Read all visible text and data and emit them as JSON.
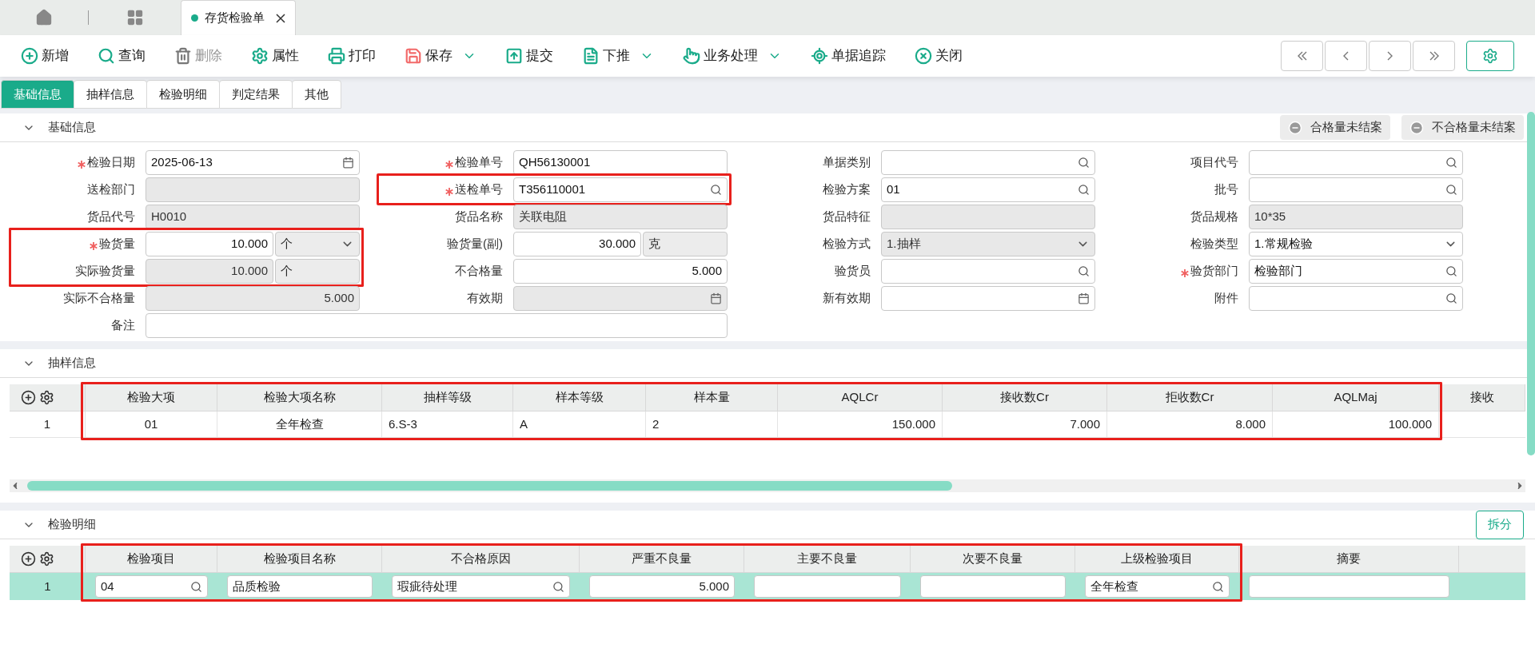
{
  "open_tabs": [
    {
      "label": "存货检验单",
      "selected": true
    }
  ],
  "toolbar": [
    {
      "label": "新增",
      "kind": "add",
      "disabled": false,
      "dropdown": false
    },
    {
      "label": "查询",
      "kind": "search",
      "disabled": false,
      "dropdown": false
    },
    {
      "label": "删除",
      "kind": "delete",
      "disabled": true,
      "dropdown": false
    },
    {
      "label": "属性",
      "kind": "settings",
      "disabled": false,
      "dropdown": false
    },
    {
      "label": "打印",
      "kind": "print",
      "disabled": false,
      "dropdown": false
    },
    {
      "label": "保存",
      "kind": "save",
      "disabled": false,
      "dropdown": true
    },
    {
      "label": "提交",
      "kind": "submit",
      "disabled": false,
      "dropdown": false
    },
    {
      "label": "下推",
      "kind": "push",
      "disabled": false,
      "dropdown": true
    },
    {
      "label": "业务处理",
      "kind": "process",
      "disabled": false,
      "dropdown": true
    },
    {
      "label": "单据追踪",
      "kind": "track",
      "disabled": false,
      "dropdown": false
    },
    {
      "label": "关闭",
      "kind": "close",
      "disabled": false,
      "dropdown": false
    }
  ],
  "section_tabs": [
    {
      "label": "基础信息",
      "selected": true
    },
    {
      "label": "抽样信息",
      "selected": false
    },
    {
      "label": "检验明细",
      "selected": false
    },
    {
      "label": "判定结果",
      "selected": false
    },
    {
      "label": "其他",
      "selected": false
    }
  ],
  "basic_info": {
    "title": "基础信息",
    "expanded": true,
    "status_buttons": [
      "合格量未结案",
      "不合格量未结案"
    ],
    "columns": [
      [
        {
          "label": "检验日期",
          "required": true,
          "kind": "date",
          "value": "2025-06-13",
          "readonly": false,
          "highlighted": false
        },
        {
          "label": "送检部门",
          "required": false,
          "kind": "text",
          "readonly": true,
          "highlighted": false
        },
        {
          "label": "货品代号",
          "required": false,
          "kind": "text",
          "value": "H0010",
          "readonly": true,
          "highlighted": false
        },
        {
          "label": "验货量",
          "required": true,
          "kind": "number",
          "value": "10.000",
          "readonly": false,
          "highlighted": true,
          "unit": {
            "value": "个",
            "kind": "select"
          }
        },
        {
          "label": "实际验货量",
          "required": false,
          "kind": "number",
          "value": "10.000",
          "readonly": true,
          "highlighted": true,
          "unit": {
            "value": "个",
            "kind": "text"
          }
        },
        {
          "label": "实际不合格量",
          "required": false,
          "kind": "number",
          "value": "5.000",
          "readonly": true,
          "highlighted": false
        }
      ],
      [
        {
          "label": "检验单号",
          "required": true,
          "kind": "text",
          "value": "QH56130001",
          "readonly": false,
          "highlighted": false
        },
        {
          "label": "送检单号",
          "required": true,
          "kind": "lookup",
          "value": "T356110001",
          "readonly": false,
          "highlighted": true
        },
        {
          "label": "货品名称",
          "required": false,
          "kind": "text",
          "value": "关联电阻",
          "readonly": true,
          "highlighted": false
        },
        {
          "label": "验货量(副)",
          "required": false,
          "kind": "number",
          "value": "30.000",
          "readonly": false,
          "highlighted": false,
          "unit": {
            "value": "克",
            "kind": "text"
          }
        },
        {
          "label": "不合格量",
          "required": false,
          "kind": "number",
          "value": "5.000",
          "readonly": false,
          "highlighted": false
        },
        {
          "label": "有效期",
          "required": false,
          "kind": "date",
          "readonly": true,
          "highlighted": false
        }
      ],
      [
        {
          "label": "单据类别",
          "required": false,
          "kind": "lookup",
          "readonly": false,
          "highlighted": false
        },
        {
          "label": "检验方案",
          "required": false,
          "kind": "lookup",
          "value": "01",
          "readonly": false,
          "highlighted": false
        },
        {
          "label": "货品特征",
          "required": false,
          "kind": "text",
          "readonly": true,
          "highlighted": false
        },
        {
          "label": "检验方式",
          "required": false,
          "kind": "select",
          "value": "1.抽样",
          "readonly": true,
          "highlighted": false
        },
        {
          "label": "验货员",
          "required": false,
          "kind": "lookup",
          "readonly": false,
          "highlighted": false
        },
        {
          "label": "新有效期",
          "required": false,
          "kind": "date",
          "readonly": false,
          "highlighted": false
        }
      ],
      [
        {
          "label": "项目代号",
          "required": false,
          "kind": "lookup",
          "readonly": false,
          "highlighted": false
        },
        {
          "label": "批号",
          "required": false,
          "kind": "lookup",
          "readonly": false,
          "highlighted": false
        },
        {
          "label": "货品规格",
          "required": false,
          "kind": "text",
          "value": "10*35",
          "readonly": true,
          "highlighted": false
        },
        {
          "label": "检验类型",
          "required": false,
          "kind": "select",
          "value": "1.常规检验",
          "readonly": false,
          "highlighted": false
        },
        {
          "label": "验货部门",
          "required": true,
          "kind": "lookup",
          "value": "检验部门",
          "readonly": false,
          "highlighted": false
        },
        {
          "label": "附件",
          "required": false,
          "kind": "lookup",
          "readonly": false,
          "highlighted": false
        }
      ]
    ],
    "remark": {
      "label": "备注",
      "required": false,
      "kind": "text",
      "readonly": false,
      "highlighted": false
    }
  },
  "sampling": {
    "title": "抽样信息",
    "expanded": true,
    "columns": [
      {
        "label": "检验大项",
        "highlighted": true
      },
      {
        "label": "检验大项名称",
        "highlighted": true
      },
      {
        "label": "抽样等级",
        "highlighted": true
      },
      {
        "label": "样本等级",
        "highlighted": true
      },
      {
        "label": "样本量",
        "highlighted": true
      },
      {
        "label": "AQLCr",
        "highlighted": true
      },
      {
        "label": "接收数Cr",
        "highlighted": true
      },
      {
        "label": "拒收数Cr",
        "highlighted": true
      },
      {
        "label": "AQLMaj",
        "highlighted": true
      },
      {
        "label": "接收",
        "highlighted": false
      }
    ],
    "rows": [
      {
        "number": "1",
        "selected": false,
        "cells": [
          "01",
          "全年检查",
          "6.S-3",
          "A",
          "2",
          "150.000",
          "7.000",
          "8.000",
          "100.000"
        ]
      }
    ]
  },
  "details": {
    "title": "检验明细",
    "expanded": true,
    "split_button": "拆分",
    "columns": [
      {
        "label": "检验项目",
        "highlighted": true
      },
      {
        "label": "检验项目名称",
        "highlighted": true
      },
      {
        "label": "不合格原因",
        "highlighted": true
      },
      {
        "label": "严重不良量",
        "highlighted": true
      },
      {
        "label": "主要不良量",
        "highlighted": true
      },
      {
        "label": "次要不良量",
        "highlighted": true
      },
      {
        "label": "上级检验项目",
        "highlighted": true
      },
      {
        "label": "摘要",
        "highlighted": false
      }
    ],
    "rows": [
      {
        "number": "1",
        "selected": true,
        "cells": [
          {
            "kind": "lookup",
            "value": "04"
          },
          {
            "kind": "text",
            "value": "品质检验"
          },
          {
            "kind": "lookup",
            "value": "瑕疵待处理"
          },
          {
            "kind": "number",
            "value": "5.000"
          },
          {
            "kind": "number"
          },
          {
            "kind": "number"
          },
          {
            "kind": "lookup",
            "value": "全年检查"
          },
          {
            "kind": "text"
          }
        ]
      }
    ]
  }
}
